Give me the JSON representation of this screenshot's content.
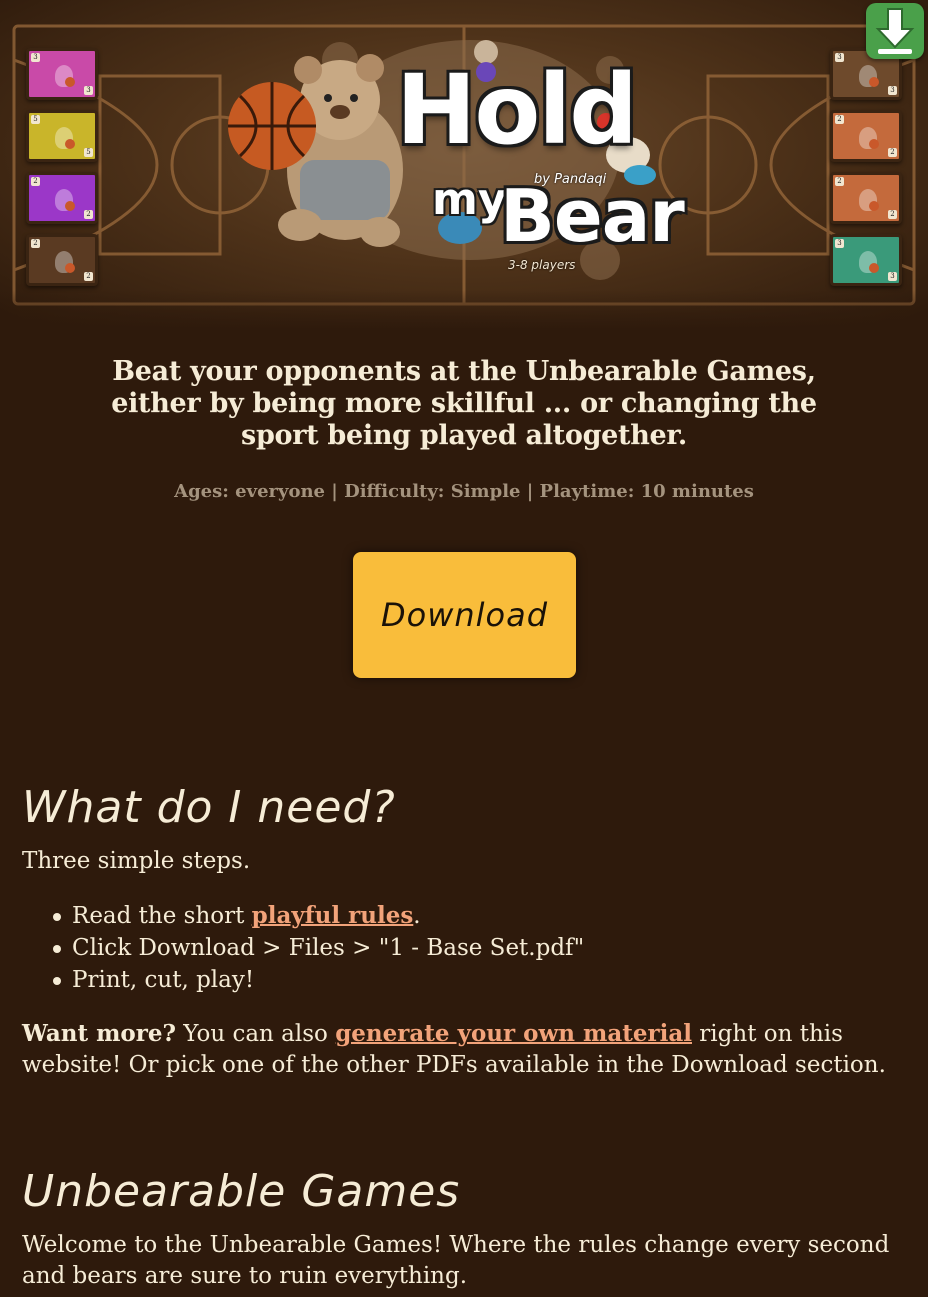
{
  "header": {
    "logo": {
      "title_line1": "Hold",
      "title_my": "my",
      "title_bear": "Bear",
      "by_line": "by Pandaqi",
      "players": "3-8 players"
    },
    "badge_icon": "download-arrow-icon",
    "left_cards": [
      {
        "color": "#c94aa8",
        "value": "3"
      },
      {
        "color": "#c9b52a",
        "value": "5"
      },
      {
        "color": "#9b37c8",
        "value": "2"
      },
      {
        "color": "#5a3a22",
        "value": "2"
      }
    ],
    "right_cards": [
      {
        "color": "#6e4a2c",
        "value": "3"
      },
      {
        "color": "#c46a3c",
        "value": "2"
      },
      {
        "color": "#c46a3c",
        "value": "2"
      },
      {
        "color": "#3a9a7a",
        "value": "3"
      }
    ]
  },
  "intro": {
    "tagline": "Beat your opponents at the Unbearable Games, either by being more skillful ... or changing the sport being played altogether.",
    "meta": "Ages: everyone | Difficulty: Simple | Playtime: 10 minutes",
    "download_label": "Download"
  },
  "need": {
    "heading": "What do I need?",
    "intro": "Three simple steps.",
    "step1_prefix": "Read the short ",
    "step1_link": "playful rules",
    "step1_suffix": ".",
    "step2": "Click Download > Files > \"1 - Base Set.pdf\"",
    "step3": "Print, cut, play!",
    "more_bold": "Want more?",
    "more_prefix": " You can also ",
    "more_link": "generate your own material",
    "more_suffix": " right on this website! Or pick one of the other PDFs available in the Download section."
  },
  "games": {
    "heading": "Unbearable Games",
    "text": "Welcome to the Unbearable Games! Where the rules change every second and bears are sure to ruin everything."
  },
  "colors": {
    "background": "#2e1a0c",
    "accent_button": "#f9bd3b",
    "link": "#f2a37a",
    "text": "#f6ecd6",
    "muted": "#a4937e"
  }
}
